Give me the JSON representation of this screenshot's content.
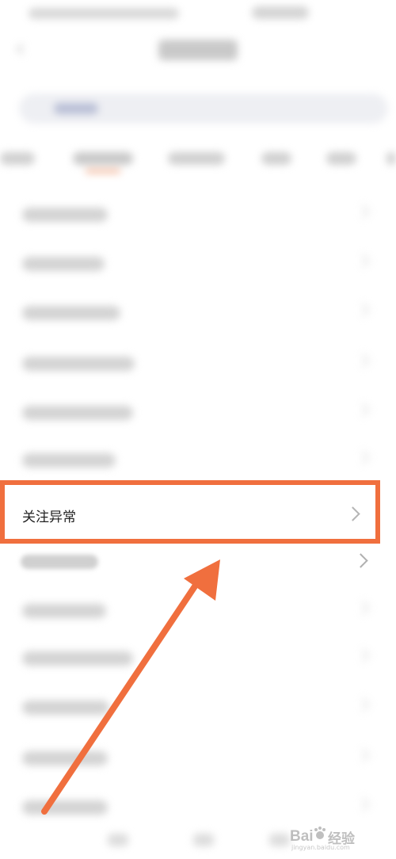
{
  "highlighted_item": {
    "label": "关注异常"
  },
  "watermark": {
    "brand_text": "经验",
    "url": "jingyan.baidu.com"
  },
  "colors": {
    "highlight_border": "#f06f3e",
    "arrow": "#f06f3e"
  }
}
